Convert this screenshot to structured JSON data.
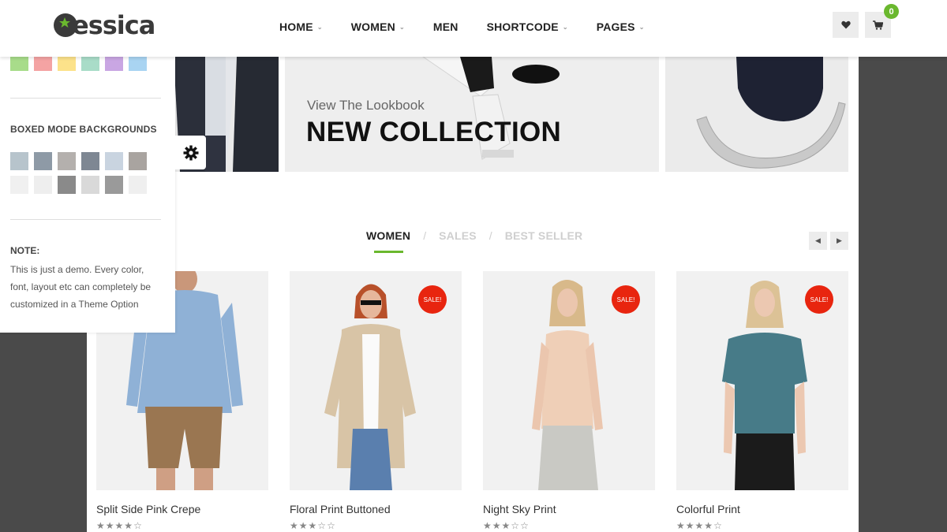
{
  "brand": {
    "logo_text": "essica",
    "accent": "#6ab82e",
    "sale_color": "#e8250f"
  },
  "nav": {
    "items": [
      {
        "label": "HOME",
        "has_dropdown": true
      },
      {
        "label": "WOMEN",
        "has_dropdown": true
      },
      {
        "label": "MEN",
        "has_dropdown": false
      },
      {
        "label": "SHORTCODE",
        "has_dropdown": true
      },
      {
        "label": "PAGES",
        "has_dropdown": true
      }
    ],
    "wishlist_icon": "heart-icon",
    "cart_icon": "cart-icon",
    "cart_count": "0"
  },
  "banner": {
    "subtitle": "View The Lookbook",
    "title": "NEW COLLECTION"
  },
  "side_panel": {
    "color_swatches": [
      "#a8dc8a",
      "#f4a3a3",
      "#fce28a",
      "#a9dcc8",
      "#c9a6e3",
      "#a9d4f2"
    ],
    "boxed_heading": "BOXED MODE BACKGROUNDS",
    "boxed_backgrounds": [
      "#b7c4cc",
      "#8e9aa6",
      "#b4b0ad",
      "#7e8793",
      "#c9d4e0",
      "#a9a4a0",
      "#f0f0f0",
      "#eeeeee",
      "#8a8a8a",
      "#d9d9d9",
      "#9a9a9a",
      "#efefef"
    ],
    "note_title": "NOTE:",
    "note_text": "This is just a demo. Every color, font, layout etc can completely be customized in a Theme Option",
    "gear_icon": "gear-icon"
  },
  "tabs": {
    "items": [
      "WOMEN",
      "SALES",
      "BEST SELLER"
    ],
    "active": "WOMEN",
    "separator": "/"
  },
  "products": [
    {
      "name": "Split Side Pink Crepe",
      "rating": 4,
      "max_rating": 5,
      "sale": false
    },
    {
      "name": "Floral Print Buttoned",
      "rating": 3,
      "max_rating": 5,
      "sale": true
    },
    {
      "name": "Night Sky Print",
      "rating": 3,
      "max_rating": 5,
      "sale": true
    },
    {
      "name": "Colorful Print",
      "rating": 4,
      "max_rating": 5,
      "sale": true
    }
  ],
  "sale_label": "SALE!"
}
